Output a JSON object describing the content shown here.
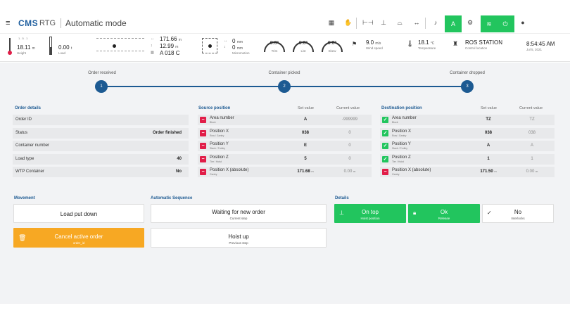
{
  "app": {
    "logo": "CMS",
    "logo_sub": "RTG",
    "mode_title": "Automatic mode",
    "auto_label": "A"
  },
  "status": {
    "height_value": "18.11",
    "height_unit": "m",
    "height_label": "Height",
    "height_scale_top": "1 . 5 . 1",
    "load_value": "0.00",
    "load_unit": "t",
    "load_label": "Load",
    "pos_x_value": "171.66",
    "pos_y_value": "12.99",
    "pos_unit": "m",
    "block_value": "A 018 C",
    "micro_x_value": "0",
    "micro_y_value": "0",
    "micro_unit": "mm",
    "micro_label": "Micromotion",
    "trim_value": "0.0°",
    "trim_label": "Trim",
    "list_value": "0.0°",
    "list_label": "List",
    "skew_value": "0.0°",
    "skew_label": "Skew",
    "wind_value": "9.0",
    "wind_unit": "m/s",
    "wind_label": "Wind speed",
    "temp_value": "18.1",
    "temp_unit": "°C",
    "temp_label": "Temperature",
    "station_value": "ROS STATION",
    "station_label": "Control location",
    "time_value": "8:54:45 AM",
    "date_value": "Jul 5, 2021"
  },
  "progress": {
    "steps": [
      {
        "number": "1",
        "label": "Order received"
      },
      {
        "number": "2",
        "label": "Container picked"
      },
      {
        "number": "3",
        "label": "Container dropped"
      }
    ]
  },
  "order_details": {
    "title": "Order details",
    "rows": [
      {
        "key": "Order ID",
        "value": ""
      },
      {
        "key": "Status",
        "value": "Order finished"
      },
      {
        "key": "Container number",
        "value": ""
      },
      {
        "key": "Load type",
        "value": "40"
      },
      {
        "key": "WTP Container",
        "value": "No"
      }
    ]
  },
  "source": {
    "title": "Source position",
    "set_hdr": "Set value",
    "cur_hdr": "Current value",
    "rows": [
      {
        "name": "Area number",
        "sub": "Block",
        "set": "A",
        "cur": "-999999"
      },
      {
        "name": "Position X",
        "sub": "Row / Gantry",
        "set": "038",
        "cur": "0"
      },
      {
        "name": "Position Y",
        "sub": "Stack / Trolley",
        "set": "E",
        "cur": "0"
      },
      {
        "name": "Position Z",
        "sub": "Tier / Hoist",
        "set": "5",
        "cur": "0"
      },
      {
        "name": "Position X (absolute)",
        "sub": "Gantry",
        "set": "171.68",
        "set_unit": "m",
        "cur": "0.00",
        "cur_unit": "m"
      }
    ]
  },
  "destination": {
    "title": "Destination position",
    "set_hdr": "Set value",
    "cur_hdr": "Current value",
    "rows": [
      {
        "name": "Area number",
        "sub": "Block",
        "set": "TZ",
        "cur": "TZ"
      },
      {
        "name": "Position X",
        "sub": "Row / Gantry",
        "set": "038",
        "cur": "038"
      },
      {
        "name": "Position Y",
        "sub": "Stack / Trolley",
        "set": "A",
        "cur": "A"
      },
      {
        "name": "Position Z",
        "sub": "Tier / Hoist",
        "set": "1",
        "cur": "1"
      },
      {
        "name": "Position X (absolute)",
        "sub": "Gantry",
        "set": "171.50",
        "set_unit": "m",
        "cur": "0.00",
        "cur_unit": "m"
      }
    ]
  },
  "movement": {
    "title": "Movement",
    "load_put_down": "Load put down",
    "cancel_title": "Cancel active order",
    "cancel_sub": "order_id"
  },
  "sequence": {
    "title": "Automatic Sequence",
    "current_title": "Waiting for new order",
    "current_sub": "Current step",
    "previous_title": "Hoist up",
    "previous_sub": "Previous step"
  },
  "details": {
    "title": "Details",
    "hoist_title": "On top",
    "hoist_sub": "Hoist position",
    "release_title": "Ok",
    "release_sub": "Release",
    "interlocks_title": "No",
    "interlocks_sub": "Interlocks"
  },
  "colors": {
    "primary": "#1d5a92",
    "success": "#22c55e",
    "danger": "#e11d48",
    "warning": "#f7a823"
  }
}
